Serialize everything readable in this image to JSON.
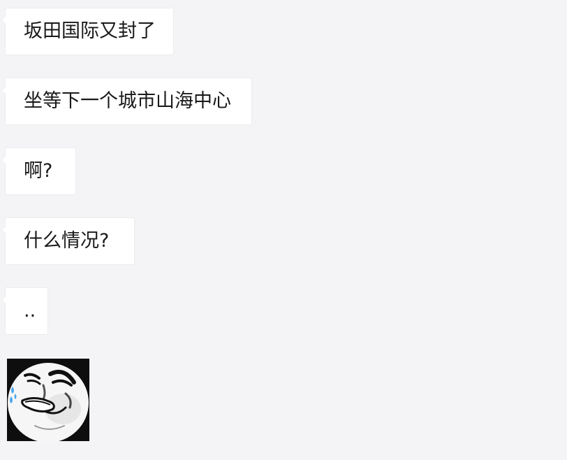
{
  "messages": [
    {
      "text": "坂田国际又封了"
    },
    {
      "text": "坐等下一个城市山海中心"
    },
    {
      "text": "啊?"
    },
    {
      "text": "什么情况?"
    },
    {
      "text": ".."
    }
  ],
  "sticker": {
    "icon": "laughing-face-sticker-icon",
    "colors": {
      "face": "#f6f6f6",
      "outline": "#0e0e0e",
      "tear": "#46a6e8"
    }
  },
  "colors": {
    "background": "#f4f3f6",
    "bubble": "#ffffff",
    "bubble_border": "#ececec",
    "text": "#191919"
  }
}
